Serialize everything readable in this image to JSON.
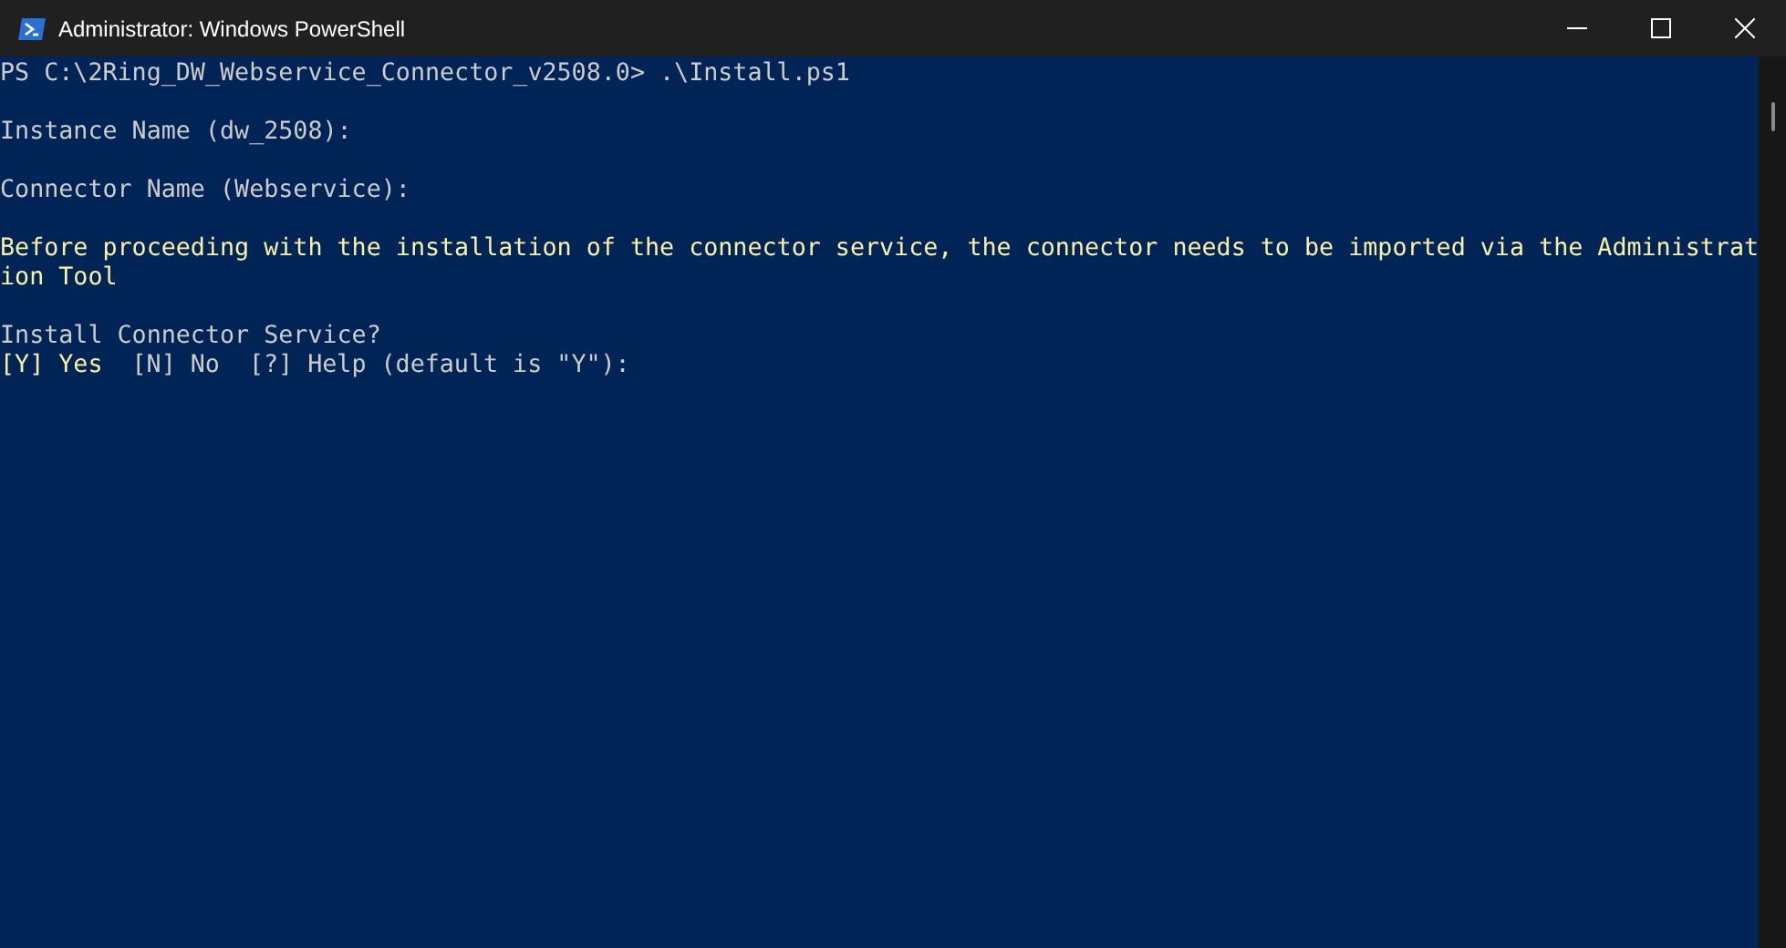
{
  "window": {
    "title": "Administrator: Windows PowerShell"
  },
  "console": {
    "blocks": [
      {
        "lines": [
          {
            "kind": "normal",
            "segments": [
              {
                "text": "PS C:\\2Ring_DW_Webservice_Connector_v2508.0> .\\Install.ps1",
                "kind": "normal"
              }
            ]
          }
        ]
      },
      {
        "lines": [
          {
            "kind": "normal",
            "segments": [
              {
                "text": "Instance Name (dw_2508):",
                "kind": "normal"
              }
            ]
          }
        ]
      },
      {
        "lines": [
          {
            "kind": "normal",
            "segments": [
              {
                "text": "Connector Name (Webservice):",
                "kind": "normal"
              }
            ]
          }
        ]
      },
      {
        "lines": [
          {
            "kind": "warning",
            "segments": [
              {
                "text": "Before proceeding with the installation of the connector service, the connector needs to be imported via the Administrat",
                "kind": "warning"
              }
            ]
          },
          {
            "kind": "warning",
            "segments": [
              {
                "text": "ion Tool",
                "kind": "warning"
              }
            ]
          }
        ]
      },
      {
        "lines": [
          {
            "kind": "normal",
            "segments": [
              {
                "text": "Install Connector Service?",
                "kind": "normal"
              }
            ]
          },
          {
            "kind": "choices",
            "segments": [
              {
                "text": "[Y] Yes",
                "kind": "default"
              },
              {
                "text": "[N] No",
                "kind": "normal"
              },
              {
                "text": "[?] Help (default is \"Y\"):",
                "kind": "normal"
              }
            ]
          }
        ]
      }
    ]
  }
}
